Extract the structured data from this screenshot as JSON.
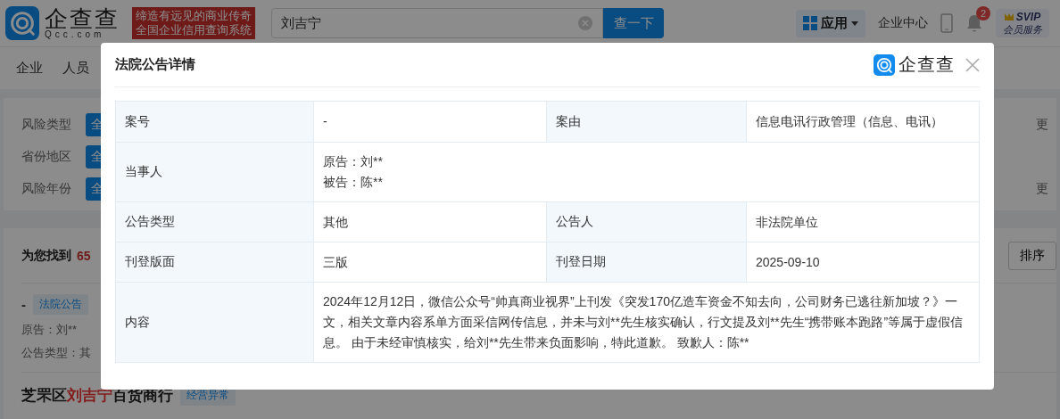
{
  "header": {
    "logo": {
      "name": "企查查",
      "domain": "Qcc.com"
    },
    "slogan": [
      "缔造有远见的商业传奇",
      "全国企业信用查询系统"
    ],
    "search": {
      "value": "刘吉宁"
    },
    "search_button": "查一下",
    "apps_menu": "应用",
    "enterprise_center": "企业中心",
    "notifications": {
      "badge": "2"
    },
    "vip": {
      "title": "SVIP",
      "subtitle": "会员服务"
    }
  },
  "nav": [
    "企业",
    "人员"
  ],
  "filters": [
    {
      "label": "风险类型",
      "option": "全",
      "more": "更"
    },
    {
      "label": "省份地区",
      "option": "全"
    },
    {
      "label": "风险年份",
      "option": "全",
      "more": "更"
    }
  ],
  "results": {
    "summary": "为您找到",
    "count": "65",
    "sort_button": "排序",
    "item": {
      "title": "-",
      "tag": "法院公告",
      "lines": [
        "原告：刘**",
        "公告类型：其"
      ]
    },
    "company": {
      "name_parts": [
        {
          "text": "芝罘区",
          "highlight": false
        },
        {
          "text": "刘吉宁",
          "highlight": true
        },
        {
          "text": "百货商行",
          "highlight": false
        }
      ],
      "tag": "经营异常"
    }
  },
  "modal": {
    "title": "法院公告详情",
    "brand": "企查查",
    "rows": [
      {
        "fields": [
          {
            "label": "案号",
            "lines": [
              "-"
            ]
          },
          {
            "label": "案由",
            "lines": [
              "信息电讯行政管理（信息、电讯）"
            ]
          }
        ]
      },
      {
        "fields": [
          {
            "label": "当事人",
            "lines": [
              "原告：刘**",
              "被告：陈**"
            ]
          }
        ]
      },
      {
        "fields": [
          {
            "label": "公告类型",
            "lines": [
              "其他"
            ]
          },
          {
            "label": "公告人",
            "lines": [
              "非法院单位"
            ]
          }
        ]
      },
      {
        "fields": [
          {
            "label": "刊登版面",
            "lines": [
              "三版"
            ]
          },
          {
            "label": "刊登日期",
            "lines": [
              "2025-09-10"
            ]
          }
        ]
      },
      {
        "fields": [
          {
            "label": "内容",
            "lines": [
              "2024年12月12日，微信公众号“帅真商业视界”上刊发《突发170亿造车资金不知去向，公司财务已逃往新加坡？》一文，相关文章内容系单方面采信网传信息，并未与刘**先生核实确认，行文提及刘**先生“携带账本跑路”等属于虚假信息。 由于未经审慎核实，给刘**先生带来负面影响，特此道歉。 致歉人：陈**"
            ]
          }
        ]
      }
    ]
  }
}
